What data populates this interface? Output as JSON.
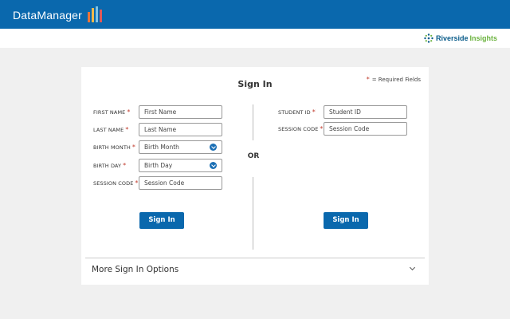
{
  "header": {
    "app_name": "DataManager",
    "logo_bar_colors": [
      "#e8743b",
      "#f2b84b",
      "#7dc3e8",
      "#e05a5a"
    ]
  },
  "subheader": {
    "brand_primary": "Riverside",
    "brand_secondary": "Insights"
  },
  "signin": {
    "title": "Sign In",
    "required_note": "= Required Fields",
    "required_marker": "*",
    "or_label": "OR",
    "left_form": {
      "fields": [
        {
          "label": "FIRST NAME",
          "placeholder": "First Name",
          "type": "text"
        },
        {
          "label": "LAST NAME",
          "placeholder": "Last Name",
          "type": "text"
        },
        {
          "label": "BIRTH MONTH",
          "placeholder": "Birth Month",
          "type": "select"
        },
        {
          "label": "BIRTH DAY",
          "placeholder": "Birth Day",
          "type": "select"
        },
        {
          "label": "SESSION CODE",
          "placeholder": "Session Code",
          "type": "text"
        }
      ],
      "button_label": "Sign In"
    },
    "right_form": {
      "fields": [
        {
          "label": "STUDENT ID",
          "placeholder": "Student ID",
          "type": "text"
        },
        {
          "label": "SESSION CODE",
          "placeholder": "Session Code",
          "type": "text"
        }
      ],
      "button_label": "Sign In"
    },
    "more_options_label": "More Sign In Options"
  },
  "colors": {
    "header_bg": "#0a68ad",
    "button_bg": "#0a68ad",
    "required_star": "#c0392b",
    "brand_blue": "#0a5c8a",
    "brand_green": "#6cb33f"
  }
}
